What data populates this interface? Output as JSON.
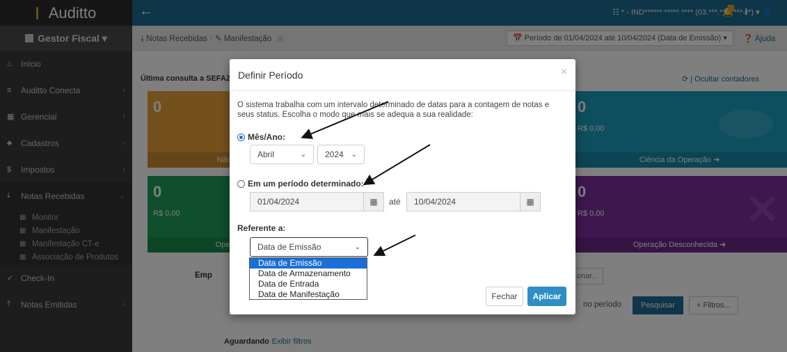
{
  "sidebar": {
    "logo_text": "Auditto",
    "module": "Gestor Fiscal ▾",
    "items": [
      {
        "icon": "home-icon",
        "glyph": "⌂",
        "label": "Início",
        "chev": ""
      },
      {
        "icon": "database-icon",
        "glyph": "≡",
        "label": "Auditto Conecta",
        "chev": "‹"
      },
      {
        "icon": "building-icon",
        "glyph": "▦",
        "label": "Gerencial",
        "chev": "‹"
      },
      {
        "icon": "sitemap-icon",
        "glyph": "♣",
        "label": "Cadastros",
        "chev": "‹"
      },
      {
        "icon": "dollar-icon",
        "glyph": "$",
        "label": "Impostos",
        "chev": "‹"
      },
      {
        "icon": "download-icon",
        "glyph": "⤓",
        "label": "Notas Recebidas",
        "chev": "⌄"
      }
    ],
    "sub_items": [
      "Monitor",
      "Manifestação",
      "Manifestação CT-e",
      "Associação de Produtos"
    ],
    "bottom_items": [
      {
        "icon": "check-icon",
        "glyph": "✓",
        "label": "Check-In",
        "chev": ""
      },
      {
        "icon": "upload-icon",
        "glyph": "⤒",
        "label": "Notas Emitidas",
        "chev": "‹"
      }
    ]
  },
  "topbar": {
    "back_glyph": "←",
    "company": "☷ * - IND****** ***** **** (03.***.***/****-**) ▾",
    "bell_glyph": "🔔",
    "info_glyph": "ℹ",
    "user_glyph": "👤"
  },
  "crumbs": {
    "first": "⤓ Notas Recebidas",
    "second": "✎ Manifestação",
    "star": "☆",
    "period": "📅 Período de 01/04/2024 até 10/04/2024 (Data de Emissão) ▾",
    "help": "❓ Ajuda"
  },
  "content": {
    "last_query": "Última consulta a SEFAZ",
    "hide_counters": "⟳ | Ocultar contadores",
    "tiles": {
      "orange": {
        "num": "0",
        "foot": "Não"
      },
      "green": {
        "num": "0",
        "val": "R$ 0,00",
        "foot": "Oper"
      },
      "teal": {
        "num": "0",
        "val": "R$ 0,00",
        "foot": "Ciência da Operação ➜"
      },
      "purple": {
        "num": "0",
        "val": "R$ 0,00",
        "foot": "Operação Desconhecida ➜"
      }
    },
    "emp_label": "Emp",
    "select_btn": "onar...",
    "no_period": "no período",
    "search_btn": "Pesquisar",
    "filters_btn": "+ Filtros...",
    "waiting": "Aguardando",
    "show_filters": "Exibir filtros"
  },
  "modal": {
    "title": "Definir Período",
    "close": "×",
    "description": "O sistema trabalha com um intervalo determinado de datas para a contagem de notas e seus status. Escolha o modo que mais se adequa a sua realidade:",
    "month_year_label": "Mês/Ano:",
    "month": "Abril",
    "year": "2024",
    "period_label": "Em um período determinado:",
    "date_from": "01/04/2024",
    "until": "até",
    "date_to": "10/04/2024",
    "cal_glyph": "▦",
    "ref_label": "Referente a:",
    "ref_selected": "Data de Emissão",
    "ref_options": [
      "Data de Emissão",
      "Data de Armazenamento",
      "Data de Entrada",
      "Data de Manifestação"
    ],
    "close_btn": "Fechar",
    "apply_btn": "Aplicar"
  },
  "colors": {
    "topbar": "#1e6d90",
    "accent": "#1a6fd8",
    "apply": "#2d8fc5"
  }
}
